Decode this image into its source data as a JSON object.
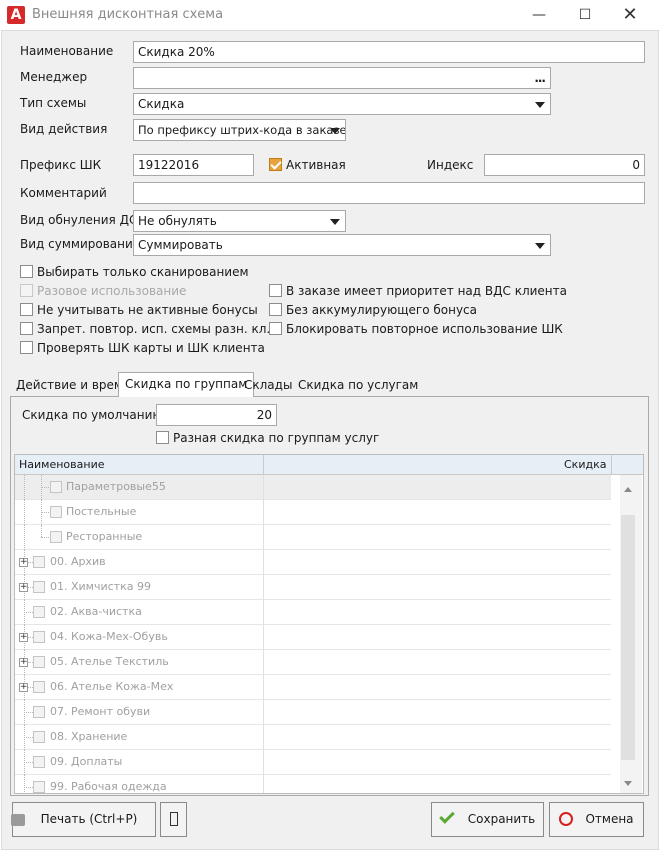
{
  "window": {
    "title": "Внешняя дисконтная схема",
    "app_icon": "app-logo-icon"
  },
  "form": {
    "name_label": "Наименование",
    "name_value": "Скидка 20%",
    "manager_label": "Менеджер",
    "manager_value": "",
    "manager_button": "...",
    "scheme_type_label": "Тип схемы",
    "scheme_type_value": "Скидка",
    "action_type_label": "Вид действия",
    "action_type_value": "По префиксу штрих-кода в заказе",
    "prefix_label": "Префикс ШК",
    "prefix_value": "19122016",
    "active_label": "Активная",
    "active_checked": true,
    "index_label": "Индекс",
    "index_value": "0",
    "comment_label": "Комментарий",
    "comment_value": "",
    "reset_label": "Вид обнуления ДС",
    "reset_value": "Не обнулять",
    "sum_label": "Вид суммирования",
    "sum_value": "Суммировать"
  },
  "options_left": [
    {
      "label": "Выбирать только сканированием",
      "checked": false,
      "disabled": false
    },
    {
      "label": "Разовое использование",
      "checked": false,
      "disabled": true
    },
    {
      "label": "Не учитывать не активные бонусы",
      "checked": false,
      "disabled": false
    },
    {
      "label": "Запрет. повтор. исп. схемы разн. кл.",
      "checked": false,
      "disabled": false
    },
    {
      "label": "Проверять ШК карты и ШК клиента",
      "checked": false,
      "disabled": false
    }
  ],
  "options_right": [
    {
      "label": "В заказе имеет приоритет над ВДС клиента",
      "checked": false
    },
    {
      "label": "Без аккумулирующего бонуса",
      "checked": false
    },
    {
      "label": "Блокировать повторное использование ШК",
      "checked": false
    }
  ],
  "tabs": [
    {
      "label": "Действие и время",
      "active": false
    },
    {
      "label": "Скидка по группам",
      "active": true
    },
    {
      "label": "Склады",
      "active": false
    },
    {
      "label": "Скидка по услугам",
      "active": false
    }
  ],
  "group_tab": {
    "default_discount_label": "Скидка по умолчанию",
    "default_discount_value": "20",
    "diff_discount_label": "Разная скидка по группам услуг",
    "diff_discount_checked": false
  },
  "grid": {
    "columns": [
      "Наименование",
      "Скидка"
    ],
    "rows": [
      {
        "name": "Параметровые55",
        "discount": "",
        "level": 1,
        "expandable": false,
        "selected": true
      },
      {
        "name": "Постельные",
        "discount": "",
        "level": 1,
        "expandable": false,
        "selected": false
      },
      {
        "name": "Ресторанные",
        "discount": "",
        "level": 1,
        "expandable": false,
        "selected": false
      },
      {
        "name": "00. Архив",
        "discount": "",
        "level": 0,
        "expandable": true,
        "selected": false
      },
      {
        "name": "01. Химчистка 99",
        "discount": "",
        "level": 0,
        "expandable": true,
        "selected": false
      },
      {
        "name": "02. Аква-чистка",
        "discount": "",
        "level": 0,
        "expandable": false,
        "selected": false
      },
      {
        "name": "04. Кожа-Мех-Обувь",
        "discount": "",
        "level": 0,
        "expandable": true,
        "selected": false
      },
      {
        "name": "05. Ателье Текстиль",
        "discount": "",
        "level": 0,
        "expandable": true,
        "selected": false
      },
      {
        "name": "06. Ателье Кожа-Мех",
        "discount": "",
        "level": 0,
        "expandable": true,
        "selected": false
      },
      {
        "name": "07. Ремонт обуви",
        "discount": "",
        "level": 0,
        "expandable": false,
        "selected": false
      },
      {
        "name": "08. Хранение",
        "discount": "",
        "level": 0,
        "expandable": false,
        "selected": false
      },
      {
        "name": "09. Доплаты",
        "discount": "",
        "level": 0,
        "expandable": false,
        "selected": false
      },
      {
        "name": "99. Рабочая одежда",
        "discount": "",
        "level": 0,
        "expandable": false,
        "selected": false
      }
    ]
  },
  "buttons": {
    "print_label": "Печать (Ctrl+P)",
    "save_label": "Сохранить",
    "cancel_label": "Отмена"
  },
  "colors": {
    "accent_checkbox": "#e8a33d",
    "save_icon": "#5aa832",
    "cancel_icon": "#d62020"
  }
}
